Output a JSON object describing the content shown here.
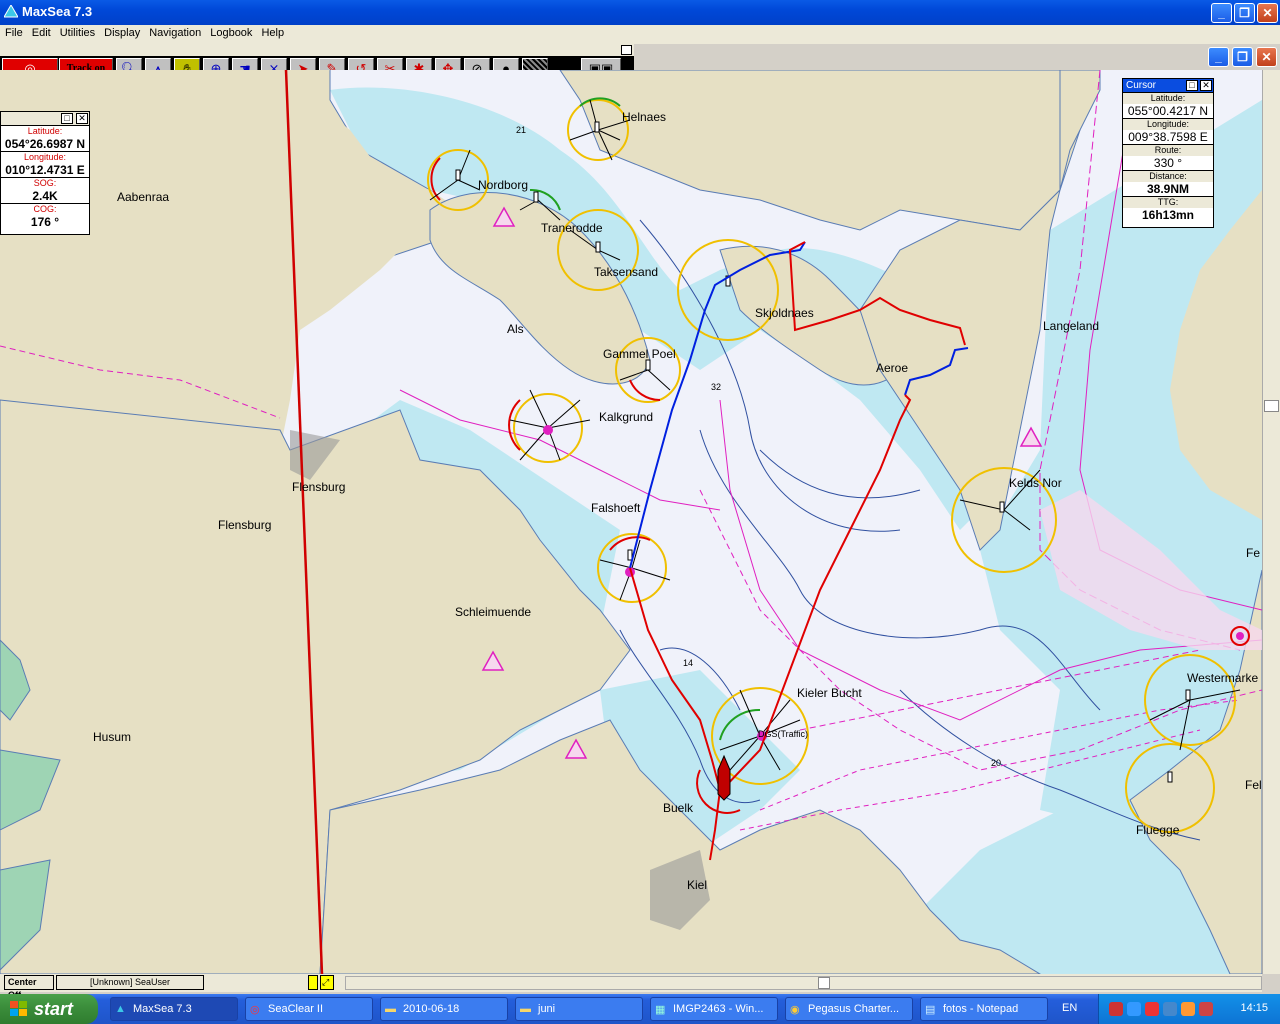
{
  "window": {
    "title": "MaxSea 7.3"
  },
  "menu": [
    "File",
    "Edit",
    "Utilities",
    "Display",
    "Navigation",
    "Logbook",
    "Help"
  ],
  "toolbar": {
    "track_label": "Track on"
  },
  "nav_panel": {
    "latitude_label": "Latitude:",
    "latitude": "054°26.6987 N",
    "longitude_label": "Longitude:",
    "longitude": "010°12.4731 E",
    "sog_label": "SOG:",
    "sog": "2.4K",
    "cog_label": "COG:",
    "cog": "176 °"
  },
  "cursor_panel": {
    "title": "Cursor",
    "latitude_label": "Latitude:",
    "latitude": "055°00.4217 N",
    "longitude_label": "Longitude:",
    "longitude": "009°38.7598 E",
    "route_label": "Route:",
    "route": "330 °",
    "distance_label": "Distance:",
    "distance": "38.9NM",
    "ttg_label": "TTG:",
    "ttg": "16h13mn"
  },
  "places": {
    "helnaes": "Helnaes",
    "aabenraa": "Aabenraa",
    "nordborg": "Nordborg",
    "tranerodde": "Tranerodde",
    "taksensand": "Taksensand",
    "als": "Als",
    "skjoldnaes": "Skjoldnaes",
    "langeland": "Langeland",
    "gammel_poel": "Gammel Poel",
    "aeroe": "Aeroe",
    "kalkgrund": "Kalkgrund",
    "flensburg1": "Flensburg",
    "flensburg2": "Flensburg",
    "falshoeft": "Falshoeft",
    "keldsnor": "Kelds Nor",
    "schleimuende": "Schleimuende",
    "kieler_bucht": "Kieler Bucht",
    "traffic": "DGS(Traffic)",
    "westermarke": "Westermarke",
    "husum": "Husum",
    "buelk": "Buelk",
    "kiel": "Kiel",
    "fluegge": "Fluegge",
    "fe1": "Fe",
    "fe2": "Fel"
  },
  "depths": {
    "d21": "21",
    "d32": "32",
    "d14": "14",
    "d20": "20"
  },
  "status": {
    "center": "Center Off",
    "user": "[Unknown] SeaUser"
  },
  "taskbar": {
    "start": "start",
    "tasks": [
      "MaxSea 7.3",
      "SeaClear II",
      "2010-06-18",
      "juni",
      "IMGP2463 - Win...",
      "Pegasus Charter...",
      "fotos - Notepad"
    ],
    "lang": "EN",
    "clock": "14:15"
  },
  "colors": {
    "land": "#e6e0c4",
    "shallow": "#bfe8f2",
    "track": "#e00000",
    "route": "#0020e0",
    "boundary": "#e020c0"
  }
}
